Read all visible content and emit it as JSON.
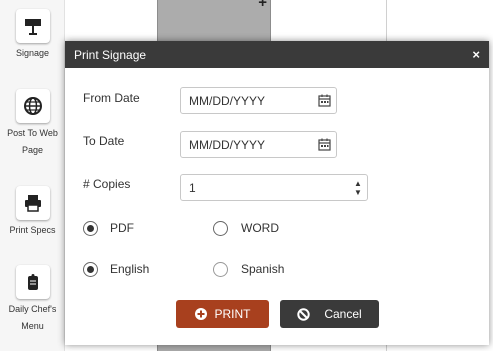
{
  "sidebar": {
    "items": [
      {
        "label_lines": [
          "Signage"
        ],
        "icon": "signage-icon"
      },
      {
        "label_lines": [
          "Post To Web",
          "Page"
        ],
        "icon": "globe-icon"
      },
      {
        "label_lines": [
          "Print Specs"
        ],
        "icon": "printer-icon"
      },
      {
        "label_lines": [
          "Daily Chef's",
          "Menu"
        ],
        "icon": "menu-card-icon"
      }
    ]
  },
  "dialog": {
    "title": "Print Signage",
    "close_label": "×",
    "from_date": {
      "label": "From Date",
      "placeholder": "MM/DD/YYYY",
      "value": ""
    },
    "to_date": {
      "label": "To Date",
      "placeholder": "MM/DD/YYYY",
      "value": ""
    },
    "copies": {
      "label": "# Copies",
      "value": "1"
    },
    "format": {
      "options": [
        {
          "label": "PDF",
          "checked": true
        },
        {
          "label": "WORD",
          "checked": false
        }
      ]
    },
    "language": {
      "options": [
        {
          "label": "English",
          "checked": true
        },
        {
          "label": "Spanish",
          "checked": false
        }
      ]
    },
    "buttons": {
      "print": "PRINT",
      "cancel": "Cancel"
    }
  },
  "colors": {
    "print_button": "#a8401e",
    "header": "#3a3a3a",
    "cancel_button": "#3a3a3a"
  }
}
